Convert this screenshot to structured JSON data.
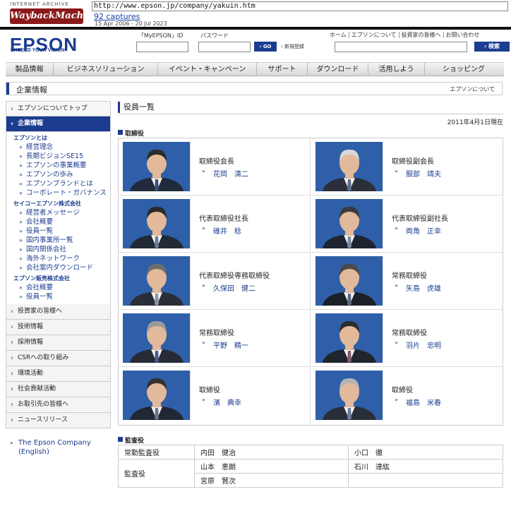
{
  "wayback": {
    "archive_label": "INTERNET ARCHIVE",
    "logo_text": "WaybackMachine",
    "url": "http://www.epson.jp/company/yakuin.htm",
    "captures": "92 captures",
    "range": "15 Apr 2006 - 20 Jul 2023"
  },
  "header": {
    "brand": "EPSON",
    "tagline": "EXCEED YOUR VISION",
    "myepson_label": "「MyEPSON」ID",
    "password_label": "パスワード",
    "go_label": "GO",
    "register_label": "新規登録",
    "top_links": [
      "ホーム",
      "エプソンについて",
      "投資家の皆様へ",
      "お問い合わせ"
    ],
    "search_label": "検索"
  },
  "nav": [
    "製品情報",
    "ビジネスソリューション",
    "イベント・キャンペーン",
    "サポート",
    "ダウンロード",
    "活用しよう",
    "ショッピング"
  ],
  "section": {
    "title": "企業情報",
    "right": "エプソンについて"
  },
  "sidebar": {
    "top": "エプソンについてトップ",
    "active": "企業情報",
    "groups": [
      {
        "heading": "エプソンとは",
        "items": [
          "経営理念",
          "長期ビジョンSE15",
          "エプソンの事業概要",
          "エプソンの歩み",
          "エプソンブランドとは",
          "コーポレート・ガバナンス"
        ]
      },
      {
        "heading": "セイコーエプソン株式会社",
        "items": [
          "経営者メッセージ",
          "会社概要",
          "役員一覧",
          "国内事業所一覧",
          "国内関係会社",
          "海外ネットワーク",
          "会社案内ダウンロード"
        ]
      },
      {
        "heading": "エプソン販売株式会社",
        "items": [
          "会社概要",
          "役員一覧"
        ]
      }
    ],
    "bottom": [
      "投資家の皆様へ",
      "技術情報",
      "採用情報",
      "CSRへの取り組み",
      "環境活動",
      "社会貢献活動",
      "お取引先の皆様へ",
      "ニュースリリース"
    ],
    "english": "The Epson Company (English)"
  },
  "main": {
    "title": "役員一覧",
    "as_of": "2011年4月1日現在",
    "directors_heading": "取締役",
    "auditors_heading": "監査役"
  },
  "directors": [
    {
      "role": "取締役会長",
      "name": "花岡　清二",
      "hair": "#2b2b2b",
      "suit": "#1f2a3a",
      "tie": "#3a4f7a"
    },
    {
      "role": "取締役副会長",
      "name": "服部　靖夫",
      "hair": "#d8d8d8",
      "suit": "#2a2f3a",
      "tie": "#5a6e8a"
    },
    {
      "role": "代表取締役社長",
      "name": "碓井　稔",
      "hair": "#2a2a2a",
      "suit": "#222a36",
      "tie": "#6a7b93"
    },
    {
      "role": "代表取締役副社長",
      "name": "両角　正幸",
      "hair": "#3a3a3a",
      "suit": "#1e2430",
      "tie": "#7a8aa0"
    },
    {
      "role": "代表取締役専務取締役",
      "name": "久保田　健二",
      "hair": "#6e6e6e",
      "suit": "#2a2e36",
      "tie": "#8a94a6"
    },
    {
      "role": "常務取締役",
      "name": "矢島　虎雄",
      "hair": "#4a4a4a",
      "suit": "#1c2028",
      "tie": "#5c6a86"
    },
    {
      "role": "常務取締役",
      "name": "平野　精一",
      "hair": "#9a9a9a",
      "suit": "#262b36",
      "tie": "#4a5c86"
    },
    {
      "role": "常務取締役",
      "name": "羽片　忠明",
      "hair": "#2c2c2c",
      "suit": "#20252e",
      "tie": "#7d5a6a"
    },
    {
      "role": "取締役",
      "name": "濱　典幸",
      "hair": "#333333",
      "suit": "#222833",
      "tie": "#6a7390"
    },
    {
      "role": "取締役",
      "name": "福島　米春",
      "hair": "#b4b4b4",
      "suit": "#2a2e38",
      "tie": "#6a7b9a"
    }
  ],
  "auditors": {
    "full_time_label": "常勤監査役",
    "label": "監査役",
    "full_time": [
      "内田　健治",
      "小口　徹"
    ],
    "others": [
      "山本　恵朗",
      "石川　達紘",
      "宮原　賢次"
    ]
  },
  "colors": {
    "brand": "#1b3c8f",
    "photo_bg": "#2f5fa8"
  }
}
